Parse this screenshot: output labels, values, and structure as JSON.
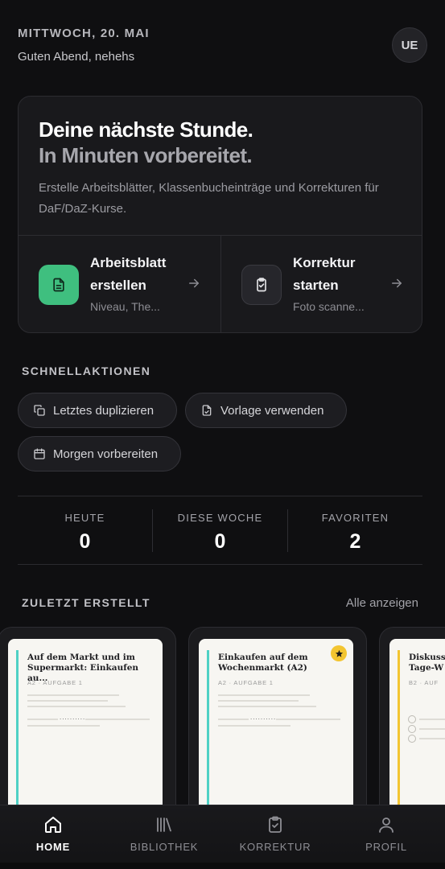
{
  "header": {
    "date": "MITTWOCH, 20. MAI",
    "greeting": "Guten Abend, nehehs",
    "avatar_initials": "UE"
  },
  "hero": {
    "title_line1": "Deine nächste Stunde.",
    "title_line2": "In Minuten vorbereitet.",
    "description": "Erstelle Arbeitsblätter, Klassenbucheinträge und Korrekturen für DaF/DaZ-Kurse.",
    "actions": [
      {
        "title": "Arbeitsblatt erstellen",
        "subtitle": "Niveau, The...",
        "icon": "document-icon",
        "accent": "#3fbf7f"
      },
      {
        "title": "Korrektur starten",
        "subtitle": "Foto scanne...",
        "icon": "clipboard-check-icon"
      }
    ]
  },
  "quick_actions": {
    "heading": "SCHNELLAKTIONEN",
    "items": [
      {
        "label": "Letztes duplizieren",
        "icon": "copy-icon"
      },
      {
        "label": "Vorlage verwenden",
        "icon": "file-template-icon"
      },
      {
        "label": "Morgen vorbereiten",
        "icon": "calendar-icon"
      }
    ]
  },
  "stats": [
    {
      "label": "HEUTE",
      "value": "0"
    },
    {
      "label": "DIESE WOCHE",
      "value": "0"
    },
    {
      "label": "FAVORITEN",
      "value": "2"
    }
  ],
  "recent": {
    "heading": "ZULETZT ERSTELLT",
    "see_all": "Alle anzeigen",
    "cards": [
      {
        "title": "Auf dem Markt und im Supermarkt: Einkaufen au...",
        "meta": "A2 · AUFGABE 1",
        "accent": "#4fd1c5",
        "favorite": false
      },
      {
        "title": "Einkaufen auf dem Wochenmarkt (A2)",
        "meta": "A2 · AUFGABE 1",
        "accent": "#4fd1c5",
        "favorite": true
      },
      {
        "title": "Diskuss Tage-W",
        "meta": "B2 · AUF",
        "accent": "#f3c531",
        "favorite": false
      }
    ]
  },
  "tabbar": {
    "tabs": [
      {
        "label": "HOME",
        "icon": "home-icon",
        "active": true
      },
      {
        "label": "BIBLIOTHEK",
        "icon": "library-icon",
        "active": false
      },
      {
        "label": "KORREKTUR",
        "icon": "clipboard-check-icon",
        "active": false
      },
      {
        "label": "PROFIL",
        "icon": "user-icon",
        "active": false
      }
    ]
  },
  "colors": {
    "background": "#0f0f11",
    "card": "#19191c",
    "accent_green": "#3fbf7f",
    "favorite_yellow": "#f3c531",
    "teal": "#4fd1c5"
  }
}
